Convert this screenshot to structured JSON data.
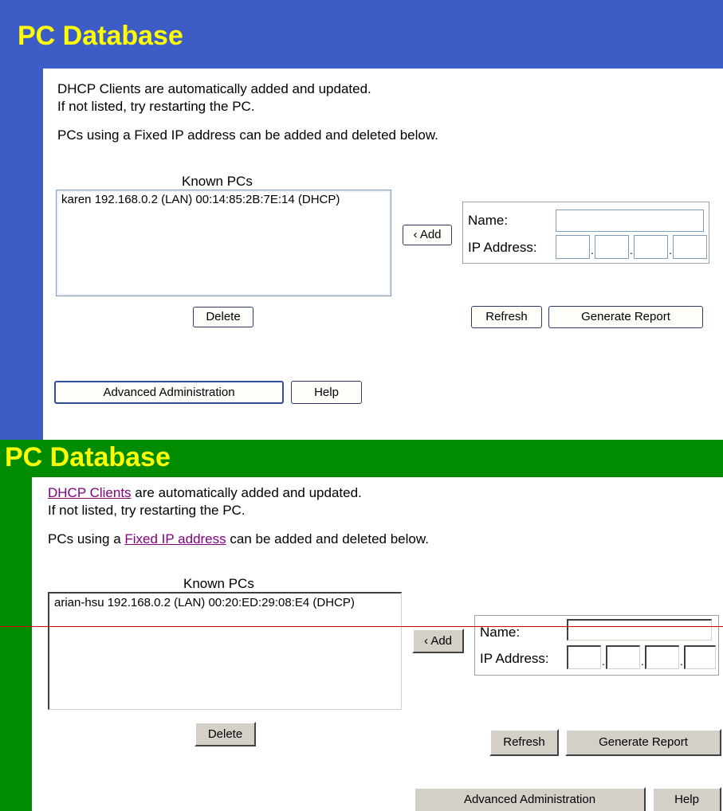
{
  "top": {
    "title": "PC Database",
    "colors": {
      "bar": "#3d5cc6",
      "title_text": "#ffff00"
    },
    "intro_line1": "DHCP Clients are automatically added and updated.",
    "intro_line2": "If not listed, try restarting the PC.",
    "intro_line3": "PCs using a Fixed IP address can be added and deleted below.",
    "known_pcs_label": "Known PCs",
    "known_pcs": [
      "karen 192.168.0.2 (LAN) 00:14:85:2B:7E:14 (DHCP)"
    ],
    "add_label": "‹ Add",
    "name_label": "Name:",
    "ip_label": "IP Address:",
    "name_value": "",
    "ip_octets": [
      "",
      "",
      "",
      ""
    ],
    "delete_label": "Delete",
    "refresh_label": "Refresh",
    "report_label": "Generate Report",
    "admin_label": "Advanced Administration",
    "help_label": "Help"
  },
  "bottom": {
    "title": "PC Database",
    "colors": {
      "bar": "#008c00",
      "title_text": "#ffff00",
      "link": "#800080",
      "guide_line": "#cc0000"
    },
    "dhcp_link": "DHCP Clients",
    "intro_line1_rest": " are automatically added and updated.",
    "intro_line2": "If not listed, try restarting the PC.",
    "intro_line3_pre": "PCs using a ",
    "fixed_ip_link": "Fixed IP address",
    "intro_line3_post": " can be added and deleted below.",
    "known_pcs_label": "Known PCs",
    "known_pcs": [
      "arian-hsu 192.168.0.2 (LAN) 00:20:ED:29:08:E4 (DHCP)"
    ],
    "add_label": "‹ Add",
    "name_label": "Name:",
    "ip_label": "IP Address:",
    "name_value": "",
    "ip_octets": [
      "",
      "",
      "",
      ""
    ],
    "delete_label": "Delete",
    "refresh_label": "Refresh",
    "report_label": "Generate Report",
    "admin_label": "Advanced Administration",
    "help_label": "Help"
  }
}
